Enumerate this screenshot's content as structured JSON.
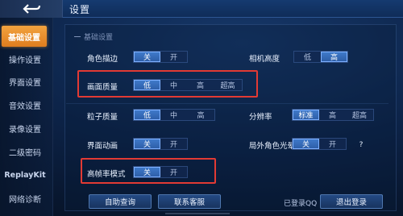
{
  "header": {
    "title": "设置"
  },
  "sidebar": {
    "items": [
      {
        "label": "基础设置",
        "active": true
      },
      {
        "label": "操作设置",
        "active": false
      },
      {
        "label": "界面设置",
        "active": false
      },
      {
        "label": "音效设置",
        "active": false
      },
      {
        "label": "录像设置",
        "active": false
      },
      {
        "label": "二级密码",
        "active": false
      },
      {
        "label": "ReplayKit",
        "active": false
      },
      {
        "label": "网络诊断",
        "active": false
      }
    ]
  },
  "section": {
    "title": "基础设置"
  },
  "settings": {
    "role_outline": {
      "label": "角色描边",
      "options": [
        "关",
        "开"
      ],
      "selected": "关"
    },
    "camera_height": {
      "label": "相机高度",
      "options": [
        "低",
        "高"
      ],
      "selected": "高"
    },
    "graphics_quality": {
      "label": "画面质量",
      "options": [
        "低",
        "中",
        "高",
        "超高"
      ],
      "selected": "低"
    },
    "particle_quality": {
      "label": "粒子质量",
      "options": [
        "低",
        "中",
        "高"
      ],
      "selected": "低"
    },
    "resolution": {
      "label": "分辨率",
      "options": [
        "标准",
        "高",
        "超高"
      ],
      "selected": "标准"
    },
    "ui_animation": {
      "label": "界面动画",
      "options": [
        "关",
        "开"
      ],
      "selected": "关"
    },
    "outside_halo": {
      "label": "局外角色光晕",
      "options": [
        "关",
        "开"
      ],
      "selected": "关",
      "help": "?"
    },
    "high_fps": {
      "label": "高帧率模式",
      "options": [
        "关",
        "开"
      ],
      "selected": "关"
    }
  },
  "footer": {
    "self_check_label": "自助查询",
    "contact_label": "联系客服",
    "logged_text": "已登录QQ",
    "logout_label": "退出登录"
  },
  "colors": {
    "active_tab": "#f2a33f",
    "selected_option": "#3f79c9",
    "highlight_box": "#e23a34"
  }
}
